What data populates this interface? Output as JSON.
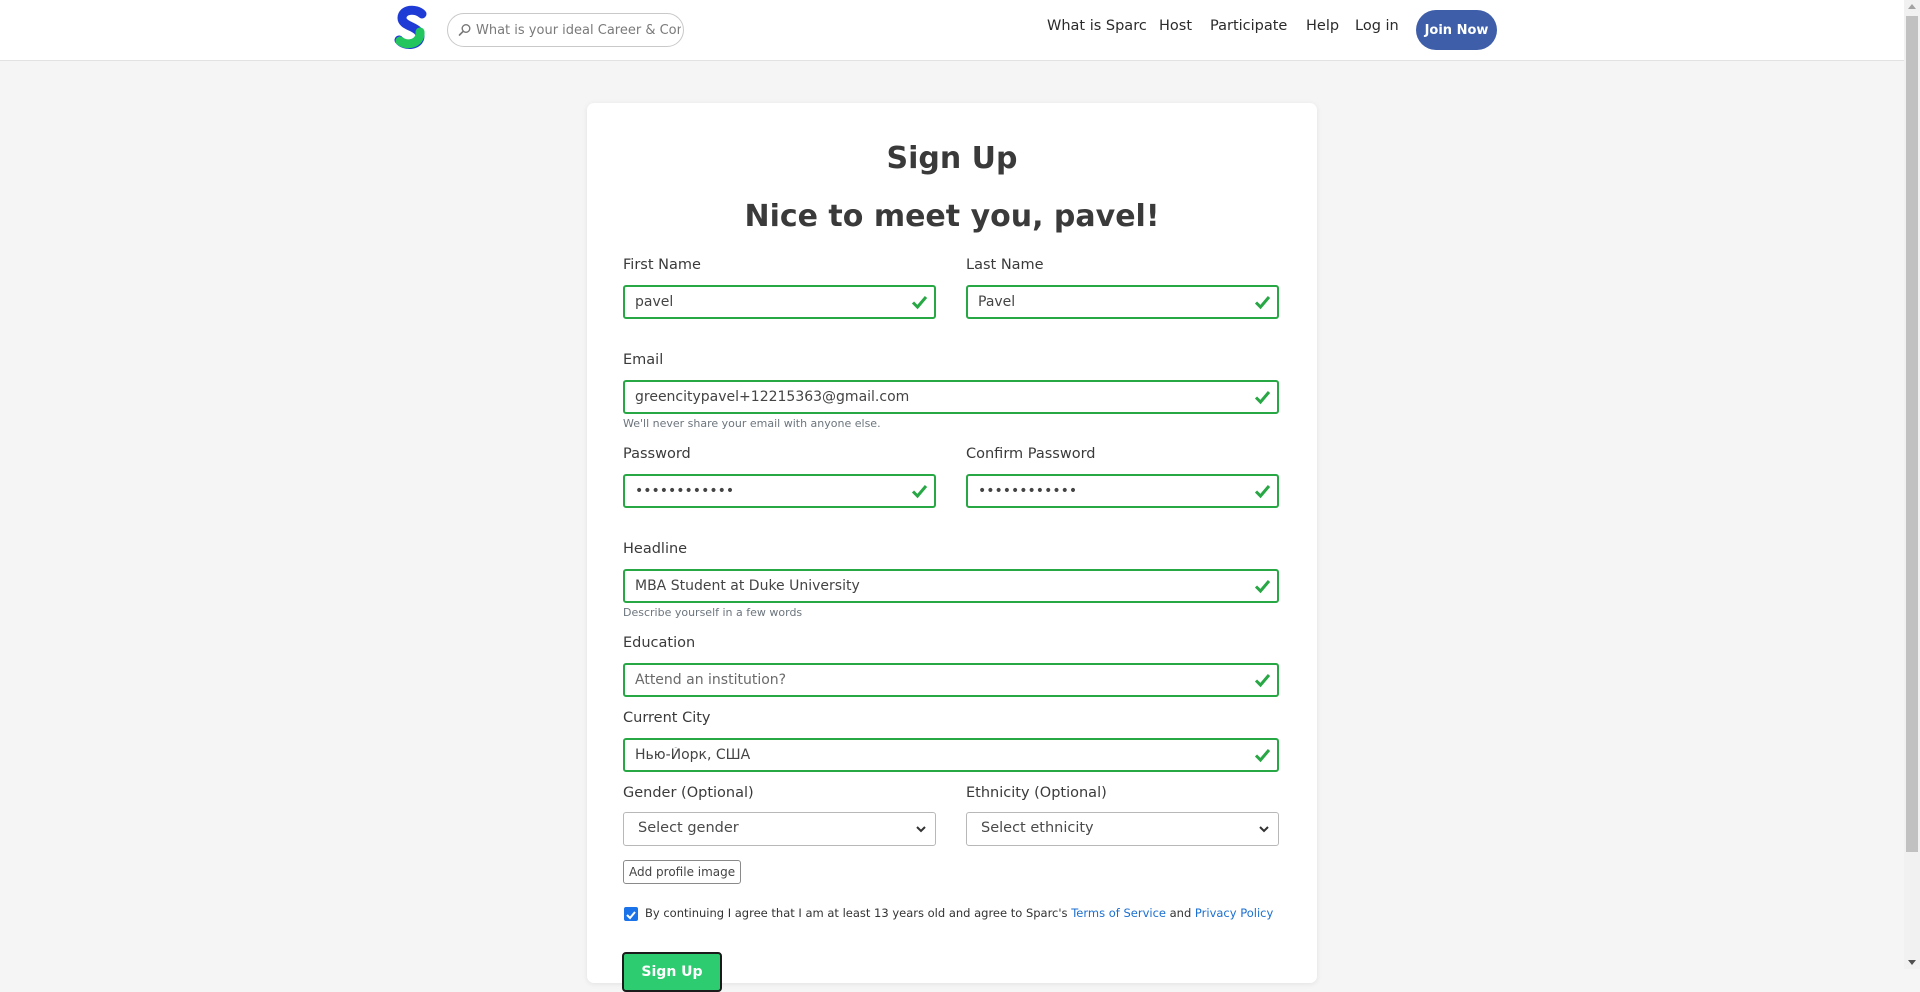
{
  "header": {
    "search_placeholder": "What is your ideal Career & Company?",
    "nav": {
      "what_is": "What is Sparc",
      "host": "Host",
      "participate": "Participate",
      "help": "Help",
      "login": "Log in"
    },
    "join_label": "Join Now"
  },
  "form": {
    "title": "Sign Up",
    "greeting": "Nice to meet you, pavel!",
    "first_name": {
      "label": "First Name",
      "value": "pavel"
    },
    "last_name": {
      "label": "Last Name",
      "value": "Pavel"
    },
    "email": {
      "label": "Email",
      "value": "greencitypavel+12215363@gmail.com",
      "help": "We'll never share your email with anyone else."
    },
    "password": {
      "label": "Password",
      "value": "••••••••••••"
    },
    "confirm_password": {
      "label": "Confirm Password",
      "value": "••••••••••••"
    },
    "headline": {
      "label": "Headline",
      "value": "MBA Student at Duke University",
      "help": "Describe yourself in a few words"
    },
    "education": {
      "label": "Education",
      "placeholder": "Attend an institution?"
    },
    "current_city": {
      "label": "Current City",
      "value": "Нью-Йорк, США"
    },
    "gender": {
      "label": "Gender (Optional)",
      "selected": "Select gender"
    },
    "ethnicity": {
      "label": "Ethnicity (Optional)",
      "selected": "Select ethnicity"
    },
    "add_image_label": "Add profile image",
    "agree": {
      "checked": true,
      "text_before": "By continuing I agree that I am at least 13 years old and agree to Sparc's ",
      "terms": "Terms of Service",
      "and": " and ",
      "privacy": "Privacy Policy"
    },
    "submit_label": "Sign Up"
  },
  "colors": {
    "brand_blue": "#3e5ea9",
    "valid_green": "#28a745",
    "submit_green": "#2ecc71",
    "link_blue": "#1b6fd0"
  }
}
